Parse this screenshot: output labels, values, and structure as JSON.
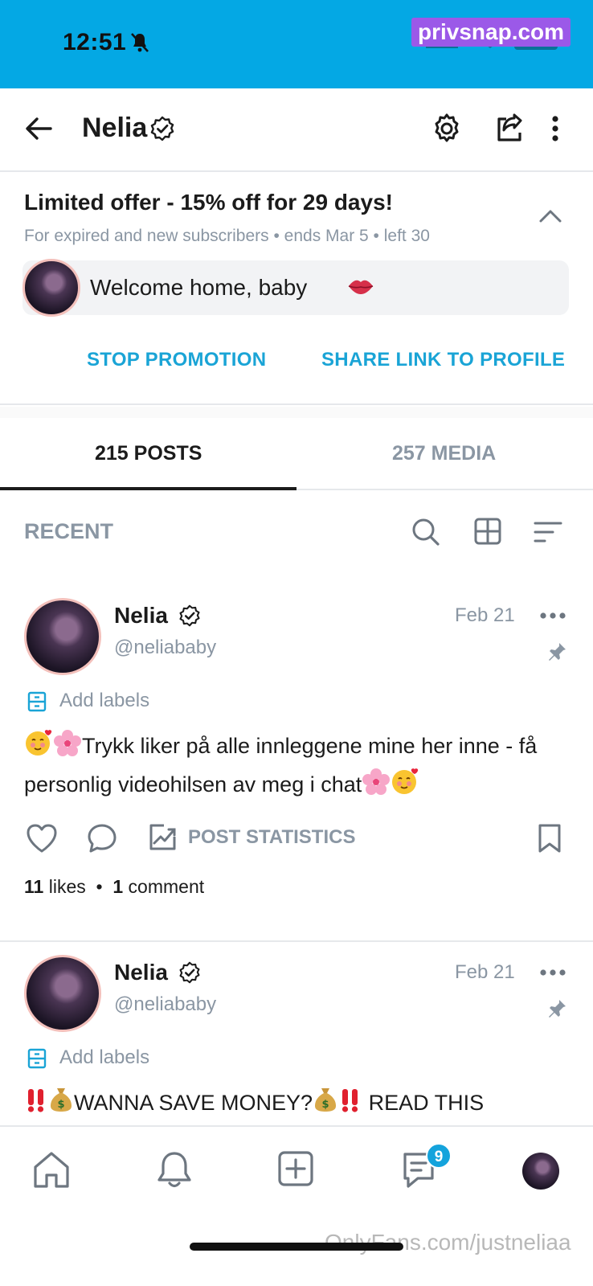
{
  "status_bar": {
    "time": "12:51",
    "watermark": "privsnap.com",
    "background_color": "#04a8e4"
  },
  "header": {
    "title": "Nelia",
    "icons": [
      "back-arrow-icon",
      "verified-badge-icon",
      "gear-icon",
      "share-icon",
      "more-vertical-icon"
    ]
  },
  "promo": {
    "title": "Limited offer - 15% off for 29 days!",
    "subtitle": "For expired and new subscribers  •  ends Mar 5  •  left 30",
    "welcome_message": "Welcome home, baby",
    "stop_button": "STOP PROMOTION",
    "share_button": "SHARE LINK TO PROFILE",
    "accent_color": "#1aa4d6"
  },
  "tabs": [
    {
      "label": "215 POSTS",
      "active": true
    },
    {
      "label": "257 MEDIA",
      "active": false
    }
  ],
  "feed": {
    "section_label": "RECENT"
  },
  "posts": [
    {
      "author": "Nelia",
      "handle": "@neliababy",
      "date": "Feb 21",
      "add_labels": "Add labels",
      "text_main": "Trykk liker på alle innleggene mine her inne - få personlig videohilsen av meg i chat",
      "stats_label": "POST STATISTICS",
      "likes": "11",
      "likes_word": "likes",
      "comments": "1",
      "comments_word": "comment"
    },
    {
      "author": "Nelia",
      "handle": "@neliababy",
      "date": "Feb 21",
      "add_labels": "Add labels",
      "text_main": "WANNA SAVE MONEY?",
      "text_tail": "READ THIS"
    }
  ],
  "bottom_nav": {
    "chat_badge": "9",
    "footer_watermark": "OnlyFans.com/justneliaa",
    "icons": [
      "home-icon",
      "bell-icon",
      "add-post-icon",
      "chat-icon",
      "profile-avatar"
    ]
  }
}
